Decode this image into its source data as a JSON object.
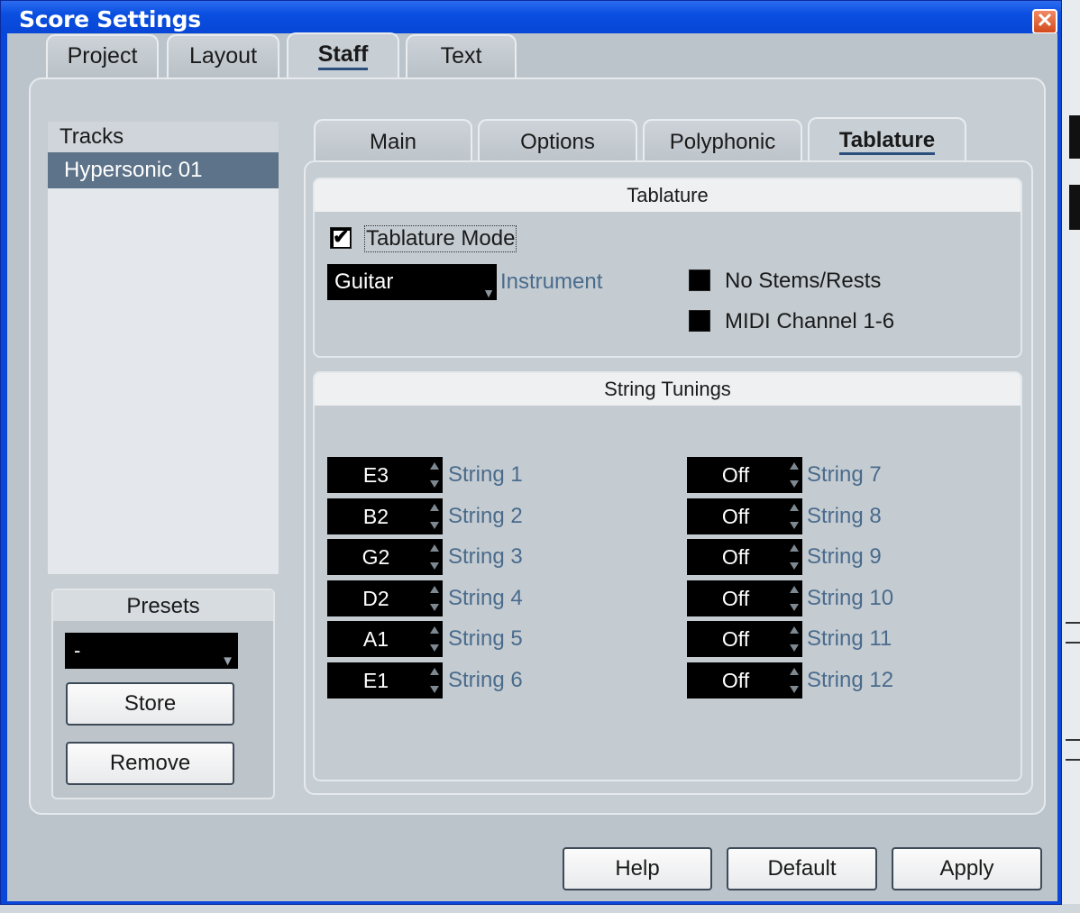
{
  "window": {
    "title": "Score Settings",
    "close_icon": "close-icon"
  },
  "outer_tabs": [
    {
      "label": "Project"
    },
    {
      "label": "Layout"
    },
    {
      "label": "Staff",
      "active": true
    },
    {
      "label": "Text"
    }
  ],
  "tracks": {
    "header": "Tracks",
    "items": [
      "Hypersonic 01"
    ]
  },
  "presets": {
    "title": "Presets",
    "selected": "-",
    "store_label": "Store",
    "remove_label": "Remove"
  },
  "inner_tabs": [
    {
      "label": "Main"
    },
    {
      "label": "Options"
    },
    {
      "label": "Polyphonic"
    },
    {
      "label": "Tablature",
      "active": true
    }
  ],
  "tablature": {
    "group_title": "Tablature",
    "mode_label": "Tablature Mode",
    "mode_checked": true,
    "instrument_value": "Guitar",
    "instrument_label": "Instrument",
    "no_stems_label": "No Stems/Rests",
    "no_stems_checked": false,
    "midi_channel_label": "MIDI Channel 1-6",
    "midi_channel_checked": false
  },
  "string_tunings": {
    "group_title": "String Tunings",
    "left": [
      {
        "value": "E3",
        "label": "String 1"
      },
      {
        "value": "B2",
        "label": "String 2"
      },
      {
        "value": "G2",
        "label": "String 3"
      },
      {
        "value": "D2",
        "label": "String 4"
      },
      {
        "value": "A1",
        "label": "String 5"
      },
      {
        "value": "E1",
        "label": "String 6"
      }
    ],
    "right": [
      {
        "value": "Off",
        "label": "String 7"
      },
      {
        "value": "Off",
        "label": "String 8"
      },
      {
        "value": "Off",
        "label": "String 9"
      },
      {
        "value": "Off",
        "label": "String 10"
      },
      {
        "value": "Off",
        "label": "String 11"
      },
      {
        "value": "Off",
        "label": "String 12"
      }
    ]
  },
  "buttons": {
    "help": "Help",
    "default": "Default",
    "apply": "Apply"
  },
  "colors": {
    "titlebar": "#0a4fe0",
    "selection": "#5d7389",
    "panel": "#c6cdd3",
    "tuning_label": "#4a6b8c"
  }
}
